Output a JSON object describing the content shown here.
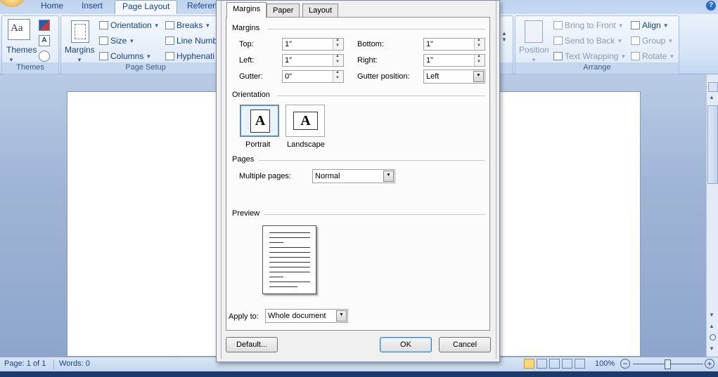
{
  "ribbon": {
    "tabs": [
      "Home",
      "Insert",
      "Page Layout",
      "Referen"
    ],
    "active_tab": "Page Layout",
    "themes_group": {
      "label": "Themes",
      "themes_button": "Themes"
    },
    "page_setup_group": {
      "label": "Page Setup",
      "margins": "Margins",
      "orientation": "Orientation",
      "size": "Size",
      "columns": "Columns",
      "breaks": "Breaks",
      "line_numbers": "Line Numb",
      "hyphenation": "Hyphenati"
    },
    "arrange_group": {
      "label": "Arrange",
      "position": "Position",
      "bring_to_front": "Bring to Front",
      "send_to_back": "Send to Back",
      "text_wrapping": "Text Wrapping",
      "align": "Align",
      "group": "Group",
      "rotate": "Rotate"
    }
  },
  "dialog": {
    "tabs": [
      "Margins",
      "Paper",
      "Layout"
    ],
    "active_tab": "Margins",
    "margins_section": "Margins",
    "top_label": "Top:",
    "top_value": "1\"",
    "bottom_label": "Bottom:",
    "bottom_value": "1\"",
    "left_label": "Left:",
    "left_value": "1\"",
    "right_label": "Right:",
    "right_value": "1\"",
    "gutter_label": "Gutter:",
    "gutter_value": "0\"",
    "gutter_position_label": "Gutter position:",
    "gutter_position_value": "Left",
    "orientation_section": "Orientation",
    "portrait": "Portrait",
    "landscape": "Landscape",
    "orientation_glyph": "A",
    "pages_section": "Pages",
    "multiple_pages_label": "Multiple pages:",
    "multiple_pages_value": "Normal",
    "preview_section": "Preview",
    "apply_to_label": "Apply to:",
    "apply_to_value": "Whole document",
    "default_button": "Default...",
    "ok_button": "OK",
    "cancel_button": "Cancel"
  },
  "status": {
    "page": "Page: 1 of 1",
    "words": "Words: 0",
    "zoom": "100%"
  },
  "colors": {
    "ribbon_text": "#15428b",
    "selected_border": "#5b8ec9"
  }
}
